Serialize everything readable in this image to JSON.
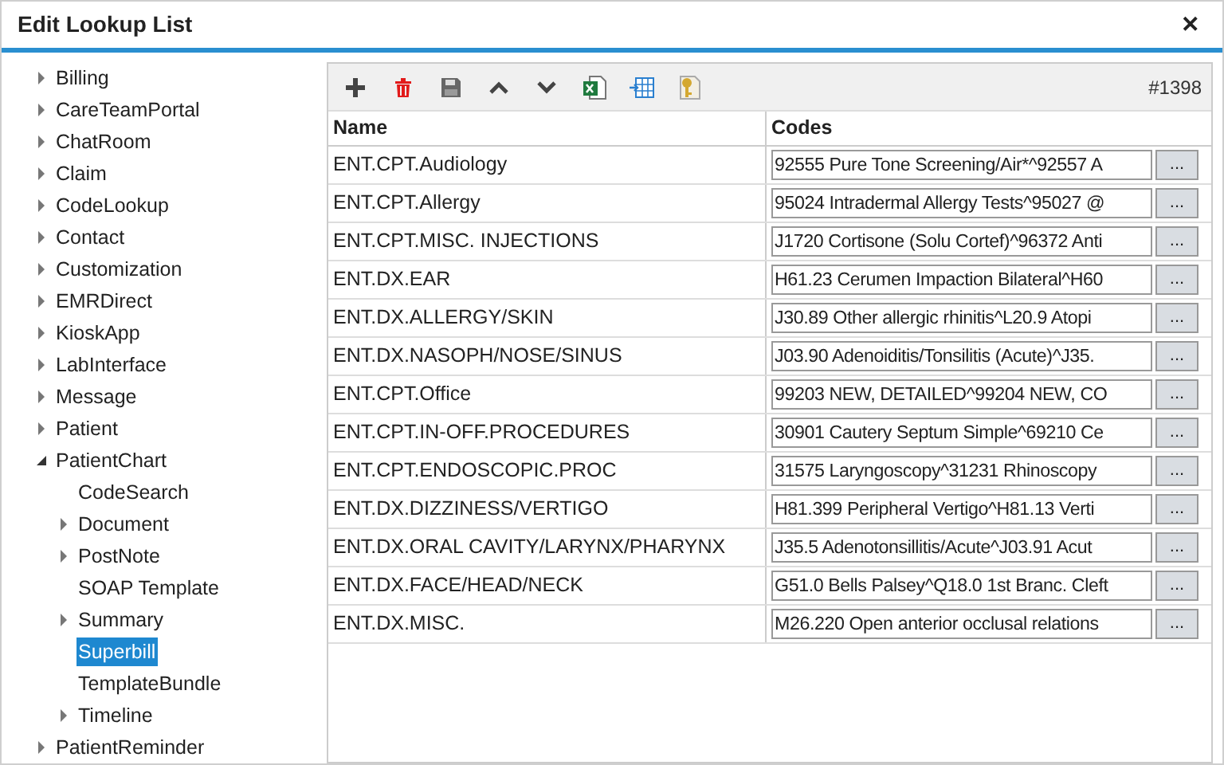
{
  "window": {
    "title": "Edit Lookup List",
    "close": "✕"
  },
  "tree": [
    {
      "label": "Billing",
      "kind": "group",
      "expanded": false,
      "selected": false
    },
    {
      "label": "CareTeamPortal",
      "kind": "group",
      "expanded": false,
      "selected": false
    },
    {
      "label": "ChatRoom",
      "kind": "group",
      "expanded": false,
      "selected": false
    },
    {
      "label": "Claim",
      "kind": "group",
      "expanded": false,
      "selected": false
    },
    {
      "label": "CodeLookup",
      "kind": "group",
      "expanded": false,
      "selected": false
    },
    {
      "label": "Contact",
      "kind": "group",
      "expanded": false,
      "selected": false
    },
    {
      "label": "Customization",
      "kind": "group",
      "expanded": false,
      "selected": false
    },
    {
      "label": "EMRDirect",
      "kind": "group",
      "expanded": false,
      "selected": false
    },
    {
      "label": "KioskApp",
      "kind": "group",
      "expanded": false,
      "selected": false
    },
    {
      "label": "LabInterface",
      "kind": "group",
      "expanded": false,
      "selected": false
    },
    {
      "label": "Message",
      "kind": "group",
      "expanded": false,
      "selected": false
    },
    {
      "label": "Patient",
      "kind": "group",
      "expanded": false,
      "selected": false
    },
    {
      "label": "PatientChart",
      "kind": "group",
      "expanded": true,
      "selected": false,
      "children": [
        {
          "label": "CodeSearch",
          "kind": "leaf",
          "selected": false
        },
        {
          "label": "Document",
          "kind": "group",
          "expanded": false,
          "selected": false
        },
        {
          "label": "PostNote",
          "kind": "group",
          "expanded": false,
          "selected": false
        },
        {
          "label": "SOAP Template",
          "kind": "leaf",
          "selected": false
        },
        {
          "label": "Summary",
          "kind": "group",
          "expanded": false,
          "selected": false
        },
        {
          "label": "Superbill",
          "kind": "leaf",
          "selected": true
        },
        {
          "label": "TemplateBundle",
          "kind": "leaf",
          "selected": false
        },
        {
          "label": "Timeline",
          "kind": "group",
          "expanded": false,
          "selected": false
        }
      ]
    },
    {
      "label": "PatientReminder",
      "kind": "group",
      "expanded": false,
      "selected": false
    }
  ],
  "toolbar": {
    "buttons": [
      {
        "kind": "add"
      },
      {
        "kind": "delete"
      },
      {
        "kind": "save"
      },
      {
        "kind": "up"
      },
      {
        "kind": "down"
      },
      {
        "kind": "excel"
      },
      {
        "kind": "import"
      },
      {
        "kind": "key"
      }
    ],
    "record": "#1398"
  },
  "table": {
    "columns": [
      "Name",
      "Codes"
    ],
    "browse": "...",
    "rows": [
      {
        "name": "ENT.CPT.Audiology",
        "codes": "92555 Pure Tone Screening/Air*^92557 A"
      },
      {
        "name": "ENT.CPT.Allergy",
        "codes": "95024 Intradermal Allergy Tests^95027 @"
      },
      {
        "name": "ENT.CPT.MISC. INJECTIONS",
        "codes": "J1720 Cortisone (Solu Cortef)^96372 Anti"
      },
      {
        "name": "ENT.DX.EAR",
        "codes": "H61.23 Cerumen Impaction Bilateral^H60"
      },
      {
        "name": "ENT.DX.ALLERGY/SKIN",
        "codes": "J30.89 Other allergic rhinitis^L20.9 Atopi"
      },
      {
        "name": "ENT.DX.NASOPH/NOSE/SINUS",
        "codes": "J03.90 Adenoiditis/Tonsilitis (Acute)^J35."
      },
      {
        "name": "ENT.CPT.Office",
        "codes": "99203 NEW, DETAILED^99204 NEW, CO"
      },
      {
        "name": "ENT.CPT.IN-OFF.PROCEDURES",
        "codes": "30901 Cautery Septum Simple^69210 Ce"
      },
      {
        "name": "ENT.CPT.ENDOSCOPIC.PROC",
        "codes": "31575 Laryngoscopy^31231 Rhinoscopy"
      },
      {
        "name": "ENT.DX.DIZZINESS/VERTIGO",
        "codes": "H81.399 Peripheral Vertigo^H81.13 Verti"
      },
      {
        "name": "ENT.DX.ORAL CAVITY/LARYNX/PHARYNX",
        "codes": "J35.5 Adenotonsillitis/Acute^J03.91 Acut"
      },
      {
        "name": "ENT.DX.FACE/HEAD/NECK",
        "codes": "G51.0 Bells Palsey^Q18.0 1st Branc. Cleft"
      },
      {
        "name": "ENT.DX.MISC.",
        "codes": "M26.220 Open anterior occlusal relations"
      }
    ]
  }
}
